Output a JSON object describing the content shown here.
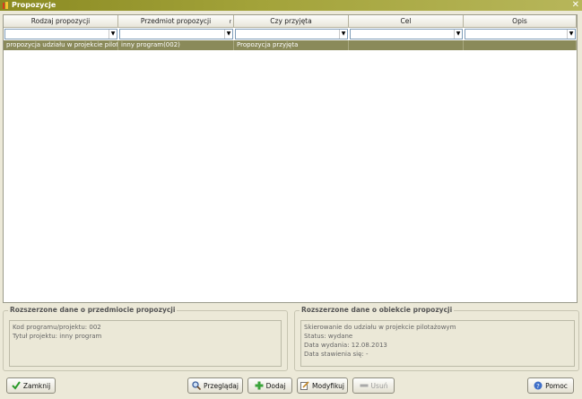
{
  "window": {
    "title": "Propozycje",
    "close_glyph": "✕"
  },
  "grid": {
    "columns": [
      {
        "label": "Rodzaj propozycji"
      },
      {
        "label": "Przedmiot propozycji",
        "sort_mark": "r"
      },
      {
        "label": "Czy przyjęta"
      },
      {
        "label": "Cel"
      },
      {
        "label": "Opis"
      }
    ],
    "filters": [
      "",
      "",
      "",
      "",
      ""
    ],
    "rows": [
      [
        "propozycja udziału w projekcie pilotaż...",
        "inny program(002)",
        "Propozycja przyjęta",
        "",
        ""
      ]
    ],
    "selected_row_color": "#8a8a5a"
  },
  "details_left": {
    "legend": "Rozszerzone dane o przedmiocie propozycji",
    "lines": [
      "Kod programu/projektu: 002",
      "Tytuł projektu: inny program"
    ]
  },
  "details_right": {
    "legend": "Rozszerzone dane o obiekcie propozycji",
    "lines": [
      "Skierowanie do udziału w projekcie pilotażowym",
      "Status: wydane",
      "Data wydania: 12.08.2013",
      "Data stawienia się: -"
    ]
  },
  "buttons": {
    "close": {
      "label": "Zamknij",
      "icon": "checkmark-icon"
    },
    "browse": {
      "label": "Przeglądaj",
      "icon": "magnifier-icon"
    },
    "add": {
      "label": "Dodaj",
      "icon": "plus-icon"
    },
    "modify": {
      "label": "Modyfikuj",
      "icon": "edit-icon"
    },
    "delete": {
      "label": "Usuń",
      "icon": "minus-icon"
    },
    "help": {
      "label": "Pomoc",
      "icon": "help-icon"
    }
  }
}
